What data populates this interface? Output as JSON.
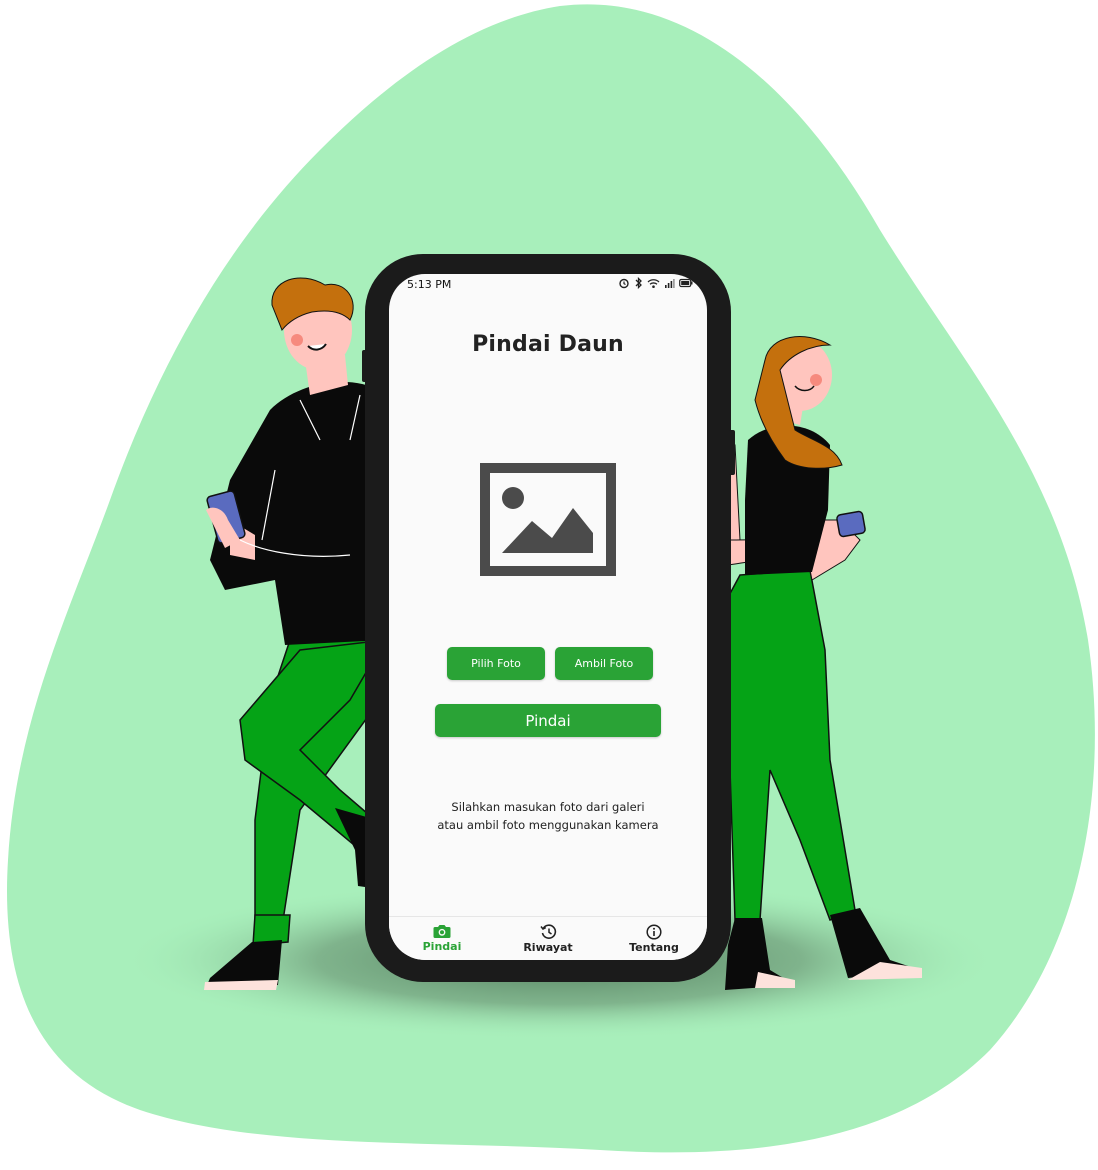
{
  "colors": {
    "blob": "#a8efbb",
    "accent": "#2aa336",
    "pants": "#05a316",
    "shirt": "#0a0a0a",
    "hair": "#c4700d",
    "skin": "#ffc5be",
    "device": "#5a6bbf",
    "phone_frame": "#1b1b1b"
  },
  "status_bar": {
    "time": "5:13 PM",
    "icons": [
      "alarm-icon",
      "bluetooth-icon",
      "wifi-icon",
      "signal-icon",
      "battery-icon"
    ]
  },
  "app": {
    "title": "Pindai Daun",
    "image_placeholder_icon": "image-icon",
    "pick_photo_label": "Pilih Foto",
    "take_photo_label": "Ambil Foto",
    "scan_label": "Pindai",
    "hint": "Silahkan masukan foto dari galeri atau ambil foto menggunakan kamera"
  },
  "bottom_nav": {
    "items": [
      {
        "label": "Pindai",
        "icon": "camera-icon",
        "active": true
      },
      {
        "label": "Riwayat",
        "icon": "history-icon",
        "active": false
      },
      {
        "label": "Tentang",
        "icon": "info-icon",
        "active": false
      }
    ]
  }
}
